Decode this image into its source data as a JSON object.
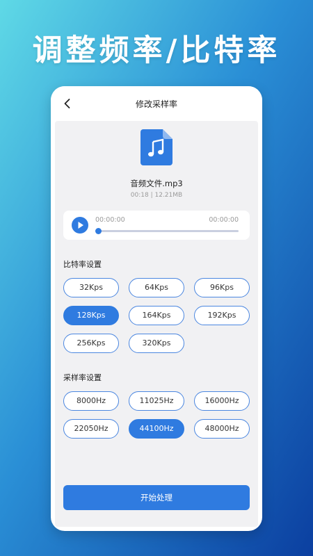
{
  "banner": {
    "title": "调整频率/比特率"
  },
  "topbar": {
    "back_icon": "chevron-left-icon",
    "title": "修改采样率"
  },
  "file": {
    "icon": "music-file-icon",
    "name": "音频文件.mp3",
    "meta": "00:18 | 12.21MB"
  },
  "player": {
    "play_icon": "play-icon",
    "current_time": "00:00:00",
    "total_time": "00:00:00",
    "progress": 0
  },
  "bitrate": {
    "label": "比特率设置",
    "options": [
      "32Kps",
      "64Kps",
      "96Kps",
      "128Kps",
      "164Kps",
      "192Kps",
      "256Kps",
      "320Kps"
    ],
    "selected": "128Kps"
  },
  "samplerate": {
    "label": "采样率设置",
    "options": [
      "8000Hz",
      "11025Hz",
      "16000Hz",
      "22050Hz",
      "44100Hz",
      "48000Hz"
    ],
    "selected": "44100Hz"
  },
  "action": {
    "start_label": "开始处理"
  },
  "colors": {
    "accent": "#2f7be0",
    "panel_bg": "#f1f1f3",
    "outline": "#4a86e0"
  }
}
